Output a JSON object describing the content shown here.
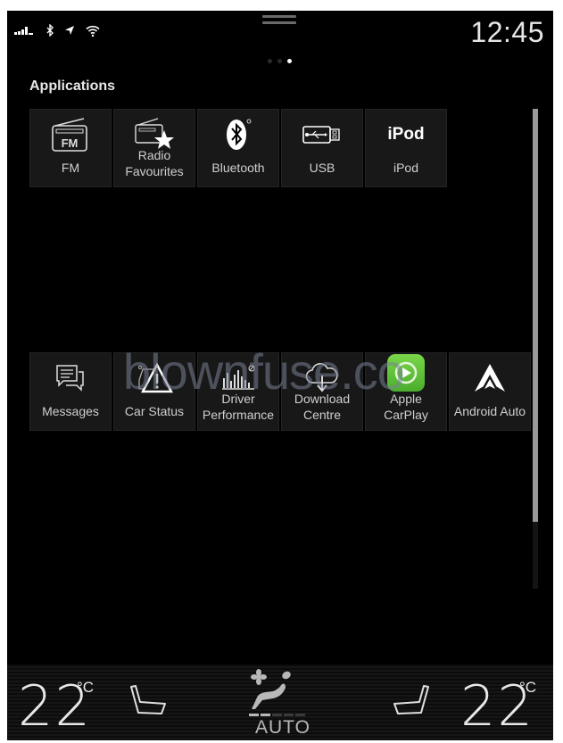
{
  "status_bar": {
    "icons": [
      "signal-strength-icon",
      "bluetooth-icon",
      "location-arrow-icon",
      "wifi-icon"
    ],
    "clock": "12:45"
  },
  "pagination": {
    "total_pages": 3,
    "active_page": 3
  },
  "section": {
    "title": "Applications"
  },
  "apps_row1": [
    {
      "id": "fm",
      "label": "FM",
      "icon": "fm-radio-icon"
    },
    {
      "id": "radio-favourites",
      "label": "Radio Favourites",
      "label_lines": [
        "Radio",
        "Favourites"
      ],
      "icon": "radio-favourites-icon"
    },
    {
      "id": "bluetooth",
      "label": "Bluetooth",
      "icon": "bluetooth-icon"
    },
    {
      "id": "usb",
      "label": "USB",
      "icon": "usb-icon"
    },
    {
      "id": "ipod",
      "label": "iPod",
      "icon_text": "iPod",
      "icon": "ipod-icon"
    }
  ],
  "apps_row2": [
    {
      "id": "messages",
      "label": "Messages",
      "icon": "messages-icon"
    },
    {
      "id": "car-status",
      "label": "Car Status",
      "icon": "car-status-warning-icon"
    },
    {
      "id": "driver-performance",
      "label": "Driver Performance",
      "label_lines": [
        "Driver",
        "Performance"
      ],
      "icon": "driver-performance-icon"
    },
    {
      "id": "download-centre",
      "label": "Download Centre",
      "label_lines": [
        "Download",
        "Centre"
      ],
      "icon": "cloud-download-icon"
    },
    {
      "id": "apple-carplay",
      "label": "Apple CarPlay",
      "label_lines": [
        "Apple",
        "CarPlay"
      ],
      "icon": "carplay-icon"
    },
    {
      "id": "android-auto",
      "label": "Android Auto",
      "icon": "android-auto-icon"
    }
  ],
  "scrollbar": {
    "thumb_fraction": 0.86,
    "position_fraction": 0
  },
  "watermark": "blownfuse.co",
  "climate": {
    "driver_temp": "22",
    "passenger_temp": "22",
    "unit": "°C",
    "fan_mode": "AUTO",
    "fan_level": 2,
    "fan_level_max": 5
  },
  "colors": {
    "background": "#000000",
    "tile": "#181818",
    "text": "#cfcfcf",
    "carplay_green": "#5cc43a"
  }
}
